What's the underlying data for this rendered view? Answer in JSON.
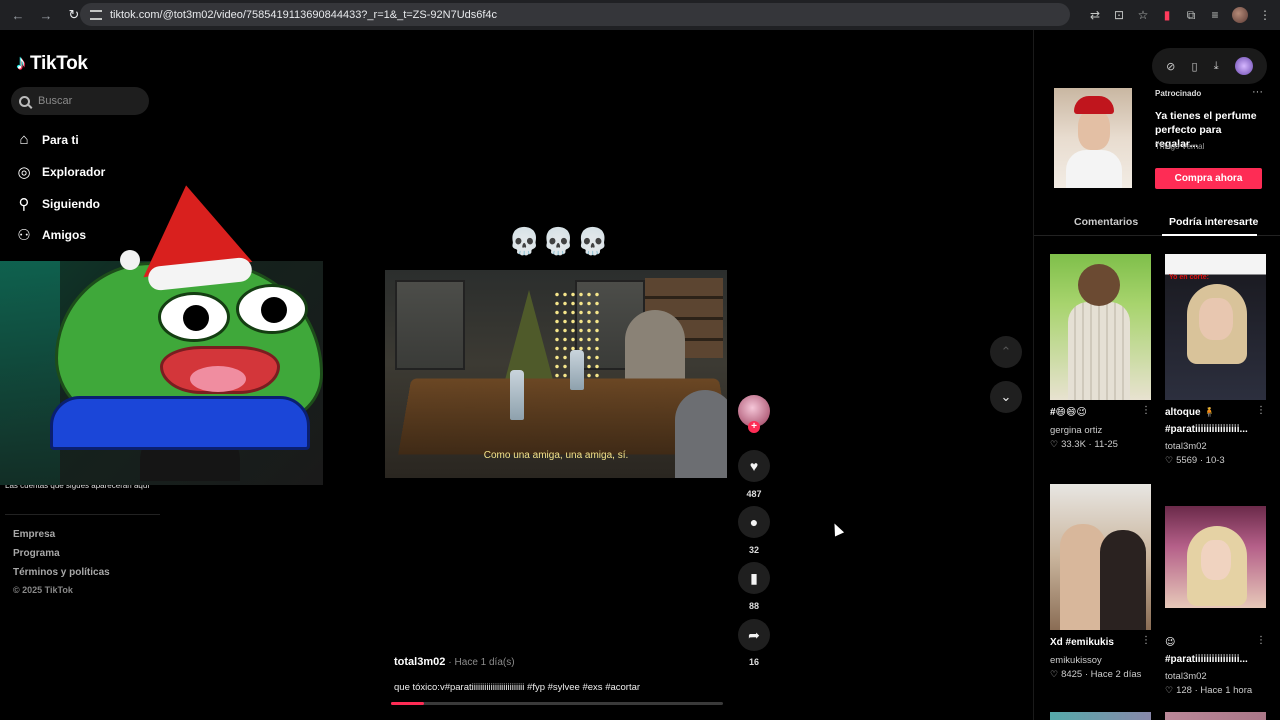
{
  "browser": {
    "url": "tiktok.com/@tot3m02/video/7585419113690844433?_r=1&_t=ZS-92N7Uds6f4c"
  },
  "sidebar": {
    "logo": "TikTok",
    "search_placeholder": "Buscar",
    "nav": [
      {
        "label": "Para ti",
        "icon": "home-icon"
      },
      {
        "label": "Explorador",
        "icon": "compass-icon"
      },
      {
        "label": "Siguiendo",
        "icon": "following-icon"
      },
      {
        "label": "Amigos",
        "icon": "friends-icon"
      }
    ],
    "following_note": "Las cuentas que sigues aparecerán aquí",
    "footer_links": [
      "Empresa",
      "Programa",
      "Términos y políticas"
    ],
    "copyright": "© 2025 TikTok"
  },
  "video": {
    "overlay_emojis": "💀💀💀",
    "subtitle": "Como una amiga, una amiga, sí.",
    "progress": 0.1,
    "likes": "487",
    "comments": "32",
    "saves": "88",
    "shares": "16",
    "creator": "total3m02",
    "posted": "Hace 1 día(s)",
    "caption": "que tóxico:v#paratiiiiiiiiiiiiiiiiiiiiiiiii #fyp #sylvee #exs #acortar"
  },
  "right_panel": {
    "ad": {
      "label": "Patrocinado",
      "title": "Ya tienes el perfume perfecto para regalar...",
      "brand": "Thiago Vernal",
      "cta": "Compra ahora"
    },
    "tabs": [
      "Comentarios",
      "Podría interesarte"
    ],
    "cards": [
      {
        "title": "#😄😄😉",
        "user": "gergina ortiz",
        "likes": "33.3K",
        "date": "11-25"
      },
      {
        "title": "altoque 🧍",
        "title2": "#paratiiiiiiiiiiiiiiii...",
        "user": "total3m02",
        "likes": "5569",
        "date": "10-3",
        "thumb_label": "Yo en corte:"
      },
      {
        "title": "Xd #emikukis",
        "user": "emikukissoy",
        "likes": "8425",
        "date": "Hace 2 días"
      },
      {
        "title": "😉",
        "title2": "#paratiiiiiiiiiiiiiiii...",
        "user": "total3m02",
        "likes": "128",
        "date": "Hace 1 hora"
      }
    ]
  }
}
